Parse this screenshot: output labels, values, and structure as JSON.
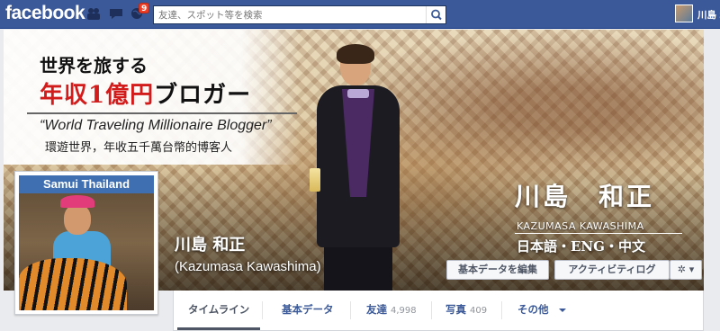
{
  "topbar": {
    "logo": "facebook",
    "notification_count": "9",
    "search_placeholder": "友達、スポット等を検索",
    "user_name": "川島 和"
  },
  "cover": {
    "promo_line1": "世界を旅する",
    "promo_line2_red": "年収1億円",
    "promo_line2_black": "ブロガー",
    "promo_line3": "“World Traveling Millionaire Blogger”",
    "promo_line4": "環遊世界，年收五千萬台幣的博客人",
    "name_kanji": "川島　和正",
    "name_roman": "KAZUMASA KAWASHIMA",
    "languages": "日本語・ENG・中文"
  },
  "profile": {
    "name": "川島 和正",
    "alt_name": "(Kazumasa Kawashima)",
    "picture_sign": "Samui Thailand"
  },
  "buttons": {
    "edit_info": "基本データを編集",
    "activity_log": "アクティビティログ",
    "settings_glyph": "✲ ▾"
  },
  "tabs": [
    {
      "label": "タイムライン",
      "count": ""
    },
    {
      "label": "基本データ",
      "count": ""
    },
    {
      "label": "友達",
      "count": "4,998"
    },
    {
      "label": "写真",
      "count": "409"
    },
    {
      "label": "その他",
      "count": ""
    }
  ],
  "colors": {
    "brand": "#3b5998",
    "badge": "#f03d25",
    "promo_red": "#d21c1c"
  }
}
